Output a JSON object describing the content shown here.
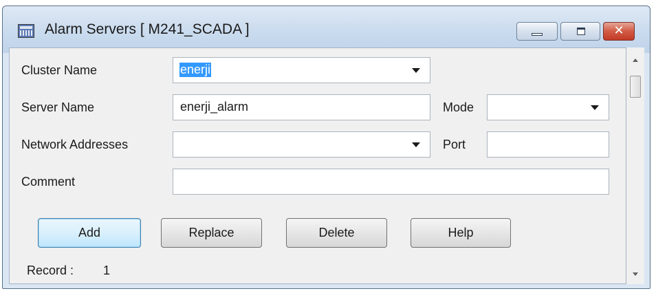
{
  "window": {
    "title": "Alarm Servers [ M241_SCADA ]",
    "icon": "app-grid-icon",
    "close_glyph": "✕"
  },
  "form": {
    "cluster_name": {
      "label": "Cluster Name",
      "value": "enerji"
    },
    "server_name": {
      "label": "Server Name",
      "value": "enerji_alarm"
    },
    "mode": {
      "label": "Mode",
      "value": ""
    },
    "network_addresses": {
      "label": "Network Addresses",
      "value": ""
    },
    "port": {
      "label": "Port",
      "value": ""
    },
    "comment": {
      "label": "Comment",
      "value": ""
    }
  },
  "buttons": {
    "add": "Add",
    "replace": "Replace",
    "delete": "Delete",
    "help": "Help"
  },
  "record": {
    "label": "Record :",
    "value": "1"
  },
  "colors": {
    "selection": "#3399ff",
    "close_button": "#c23b26",
    "default_button": "#bee6fd"
  }
}
